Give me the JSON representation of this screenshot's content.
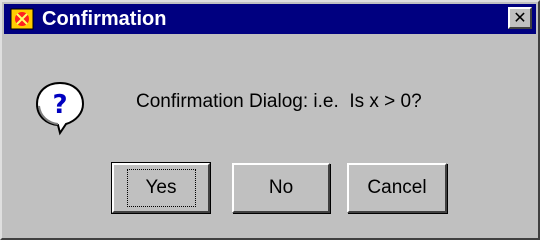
{
  "window": {
    "title": "Confirmation",
    "close_glyph": "✕"
  },
  "dialog": {
    "icon": "question-icon",
    "message": "Confirmation Dialog: i.e.  Is x > 0?"
  },
  "buttons": {
    "yes_label": "Yes",
    "no_label": "No",
    "cancel_label": "Cancel"
  },
  "colors": {
    "titlebar": "#000080",
    "face": "#c0c0c0",
    "icon_question_mark": "#0000c0"
  }
}
